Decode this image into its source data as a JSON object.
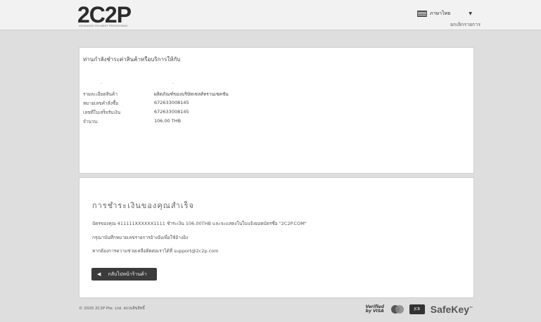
{
  "header": {
    "logo_text": "2C2P",
    "logo_sub": "ADVANCED PAYMENT PROCESSING",
    "language": "ภาษาไทย",
    "cancel_link": "ยกเลิกรายการ"
  },
  "summary": {
    "title": "ท่านกำลังชำระค่าสินค้าหรือบริการให้กับ",
    "rows": [
      {
        "label": "รายละเอียดสินค้า",
        "value": "ผลิตภัณฑ์ของบริษัทเซลส์ทรานเซคชัน"
      },
      {
        "label": "หมายเลขคำสั่งซื้อ",
        "value": "672633008145"
      },
      {
        "label": "เลขที่ใบเสร็จรับเงิน",
        "value": "672633008145"
      },
      {
        "label": "จำนวน:",
        "value": "106.00 THB"
      }
    ]
  },
  "payment": {
    "title": "การชำระเงินของคุณสำเร็จ",
    "line1": "บัตรของคุณ 411111XXXXXX1111 ชำระเงิน 106.00THB และจะแสดงในใบแจ้งยอดบัตรชื่อ \"2C2P.COM\"",
    "line2": "กรุณาบันทึกหมายเลขรายการอ้างอิงเพื่อใช้อ้างอิง",
    "line3": "หากต้องการความช่วยเหลือติดต่อเราได้ที่ support@2c2p.com",
    "back_button": "กลับไปหน้าร้านค้า"
  },
  "footer": {
    "copyright": "© 2020 2C2P Pte. Ltd. สงวนลิขสิทธิ์",
    "visa_text": "Verified by VISA",
    "jcb_text": "JCB",
    "safekey_text": "SafeKey",
    "mc_color1": "#555555",
    "mc_color2": "#888888"
  }
}
